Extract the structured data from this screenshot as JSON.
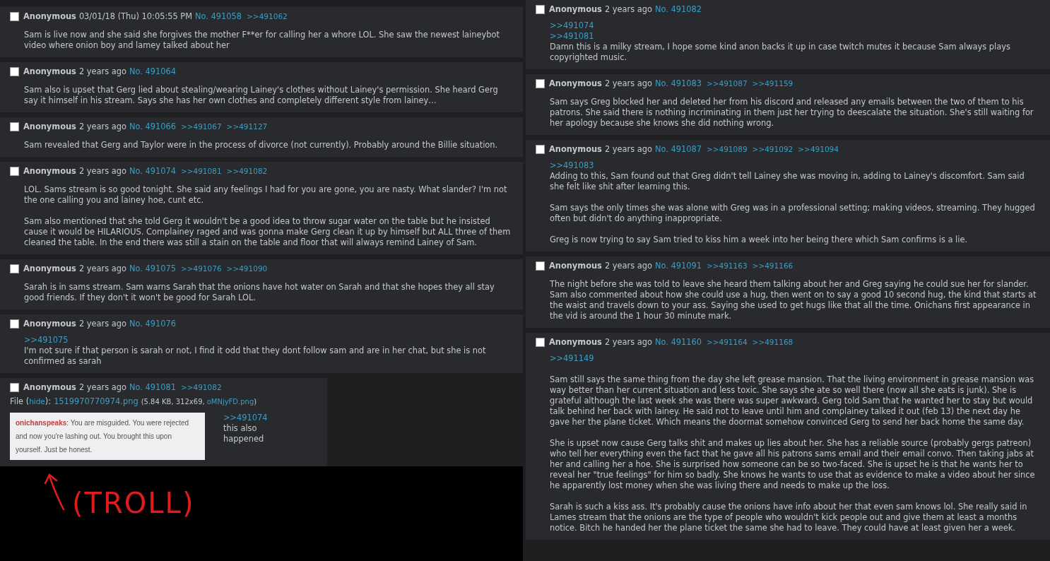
{
  "columns": [
    {
      "posts": [
        {
          "name": "Anonymous",
          "date": "03/01/18 (Thu) 10:05:55 PM",
          "no": "No. 491058",
          "backlinks": [
            ">>491062"
          ],
          "checked": false,
          "body": [
            {
              "kind": "text",
              "text": "Sam is live now and she said she forgives the mother F**er for calling her a whore LOL. She saw the newest laineybot video where onion boy and lamey talked about her"
            }
          ]
        },
        {
          "name": "Anonymous",
          "date": "2 years ago",
          "no": "No. 491064",
          "checked": false,
          "body": [
            {
              "kind": "text",
              "text": "Sam also is upset that Gerg lied about stealing/wearing Lainey's clothes without Lainey's permission. She heard Gerg say it himself in his stream. Says she has her own clothes and completely different style from lainey…"
            }
          ]
        },
        {
          "name": "Anonymous",
          "date": "2 years ago",
          "no": "No. 491066",
          "backlinks": [
            ">>491067",
            ">>491127"
          ],
          "checked": false,
          "body": [
            {
              "kind": "text",
              "text": "Sam revealed that Gerg and Taylor were in the process of divorce (not currently). Probably around the Billie situation."
            }
          ]
        },
        {
          "name": "Anonymous",
          "date": "2 years ago",
          "no": "No. 491074",
          "backlinks": [
            ">>491081",
            ">>491082"
          ],
          "checked": false,
          "body": [
            {
              "kind": "text",
              "text": "LOL. Sams stream is so good tonight. She said any feelings I had for you are gone, you are nasty. What slander? I'm not the one calling you and lainey hoe, cunt etc."
            },
            {
              "kind": "paragraph",
              "text": "Sam also mentioned that she told Gerg it wouldn't be a good idea to throw sugar water on the table but he insisted cause it would be HILARIOUS. Complainey raged and was gonna make Gerg clean it up by himself but ALL three of them cleaned the table. In the end there was still a stain on the table and floor that will always remind Lainey of Sam."
            }
          ]
        },
        {
          "name": "Anonymous",
          "date": "2 years ago",
          "no": "No. 491075",
          "backlinks": [
            ">>491076",
            ">>491090"
          ],
          "checked": false,
          "body": [
            {
              "kind": "text",
              "text": "Sarah is in sams stream. Sam warns Sarah that the onions have hot water on Sarah and that she hopes they all stay good friends. If they don't it won't be good for Sarah LOL."
            }
          ]
        },
        {
          "name": "Anonymous",
          "date": "2 years ago",
          "no": "No. 491076",
          "checked": false,
          "body": [
            {
              "kind": "quote",
              "text": ">>491075"
            },
            {
              "kind": "text",
              "text": "I'm not sure if that person is sarah or not, I find it odd that they dont follow sam and are in her chat, but she is not confirmed as sarah"
            }
          ]
        },
        {
          "name": "Anonymous",
          "date": "2 years ago",
          "no": "No. 491081",
          "backlinks": [
            ">>491082"
          ],
          "checked": false,
          "file": {
            "label": "File (",
            "hide": "hide",
            "label_end": "):",
            "filename": "1519970770974.png",
            "info": "(5.84 KB, 312x69,",
            "original": "oMNjyFD.png",
            "info_end": ")",
            "image": {
              "user": "onichanspeaks",
              "message": ": You are misguided. You were rejected and now you're lashing out. You brought this upon yourself. Just be honest."
            }
          },
          "body": [
            {
              "kind": "quote",
              "text": ">>491074"
            },
            {
              "kind": "text",
              "text": "this also happened"
            }
          ]
        }
      ]
    },
    {
      "posts": [
        {
          "name": "Anonymous",
          "date": "2 years ago",
          "no": "No. 491082",
          "checked": false,
          "body": [
            {
              "kind": "quote",
              "text": ">>491074"
            },
            {
              "kind": "quote",
              "text": ">>491081"
            },
            {
              "kind": "text",
              "text": "Damn this is a milky stream, I hope some kind anon backs it up in case twitch mutes it because Sam always plays copyrighted music."
            }
          ]
        },
        {
          "name": "Anonymous",
          "date": "2 years ago",
          "no": "No. 491083",
          "backlinks": [
            ">>491087",
            ">>491159"
          ],
          "checked": false,
          "body": [
            {
              "kind": "text",
              "text": "Sam says Greg blocked her and deleted her from his discord and released any emails between the two of them to his patrons. She said there is nothing incriminating in them just her trying to deescalate the situation. She's still waiting for her apology because she knows she did nothing wrong."
            }
          ]
        },
        {
          "name": "Anonymous",
          "date": "2 years ago",
          "no": "No. 491087",
          "backlinks": [
            ">>491089",
            ">>491092",
            ">>491094"
          ],
          "checked": false,
          "body": [
            {
              "kind": "quote",
              "text": ">>491083"
            },
            {
              "kind": "text",
              "text": "Adding to this, Sam found out that Greg didn't tell Lainey she was moving in, adding to Lainey's discomfort. Sam said she felt like shit after learning this."
            },
            {
              "kind": "paragraph",
              "text": "Sam says the only times she was alone with Greg was in a professional setting; making videos, streaming. They hugged often but didn't do anything inappropriate."
            },
            {
              "kind": "paragraph",
              "text": "Greg is now trying to say Sam tried to kiss him a week into her being there which Sam confirms is a lie."
            }
          ]
        },
        {
          "name": "Anonymous",
          "date": "2 years ago",
          "no": "No. 491091",
          "backlinks": [
            ">>491163",
            ">>491166"
          ],
          "checked": false,
          "body": [
            {
              "kind": "text",
              "text": "The night before she was told to leave she heard them talking about her and Greg saying he could sue her for slander."
            },
            {
              "kind": "text",
              "text": "Sam also commented about how she could use a hug, then went on to say a good 10 second hug, the kind that starts at the waist and travels down to your ass. Saying she used to get hugs like that all the time. Onichans first appearance in the vid is around the 1 hour 30 minute mark."
            }
          ]
        },
        {
          "name": "Anonymous",
          "date": "2 years ago",
          "no": "No. 491160",
          "backlinks": [
            ">>491164",
            ">>491168"
          ],
          "checked": false,
          "body": [
            {
              "kind": "quote",
              "text": ">>491149"
            },
            {
              "kind": "paragraph",
              "text": "Sam still says the same thing from the day she left grease mansion. That the living environment in grease mansion was way better than her current situation and less toxic. She says she ate so well there (now all she eats is junk). She is grateful although the last week she was there was super awkward. Gerg told Sam that he wanted her to stay but would talk behind her back with lainey. He said not to leave until him and complainey talked it out (feb 13) the next day he gave her the plane ticket. Which means the doormat somehow convinced Gerg to send her back home the same day."
            },
            {
              "kind": "paragraph",
              "text": "She is upset now cause Gerg talks shit and makes up lies about her. She has a reliable source (probably gergs patreon) who tell her everything even the fact that he gave all his patrons sams email and their email convo. Then taking jabs at her and calling her a hoe. She is surprised how someone can be so two-faced. She is upset he is that he wants her to reveal her \"true feelings\" for him so badly. She knows he wants to use that as evidence to make a video about her since he apparently lost money when she was living there and needs to make up the loss."
            },
            {
              "kind": "paragraph",
              "text": "Sarah is such a kiss ass. It's probably cause the onions have info about her that even sam knows lol. She really said in Lames stream that the onions are the type of people who wouldn't kick people out and give them at least a months notice. Bitch he handed her the plane ticket the same she had to leave. They could have at least given her a week."
            }
          ]
        }
      ]
    }
  ],
  "annotation": {
    "text": "(TROLL)"
  }
}
